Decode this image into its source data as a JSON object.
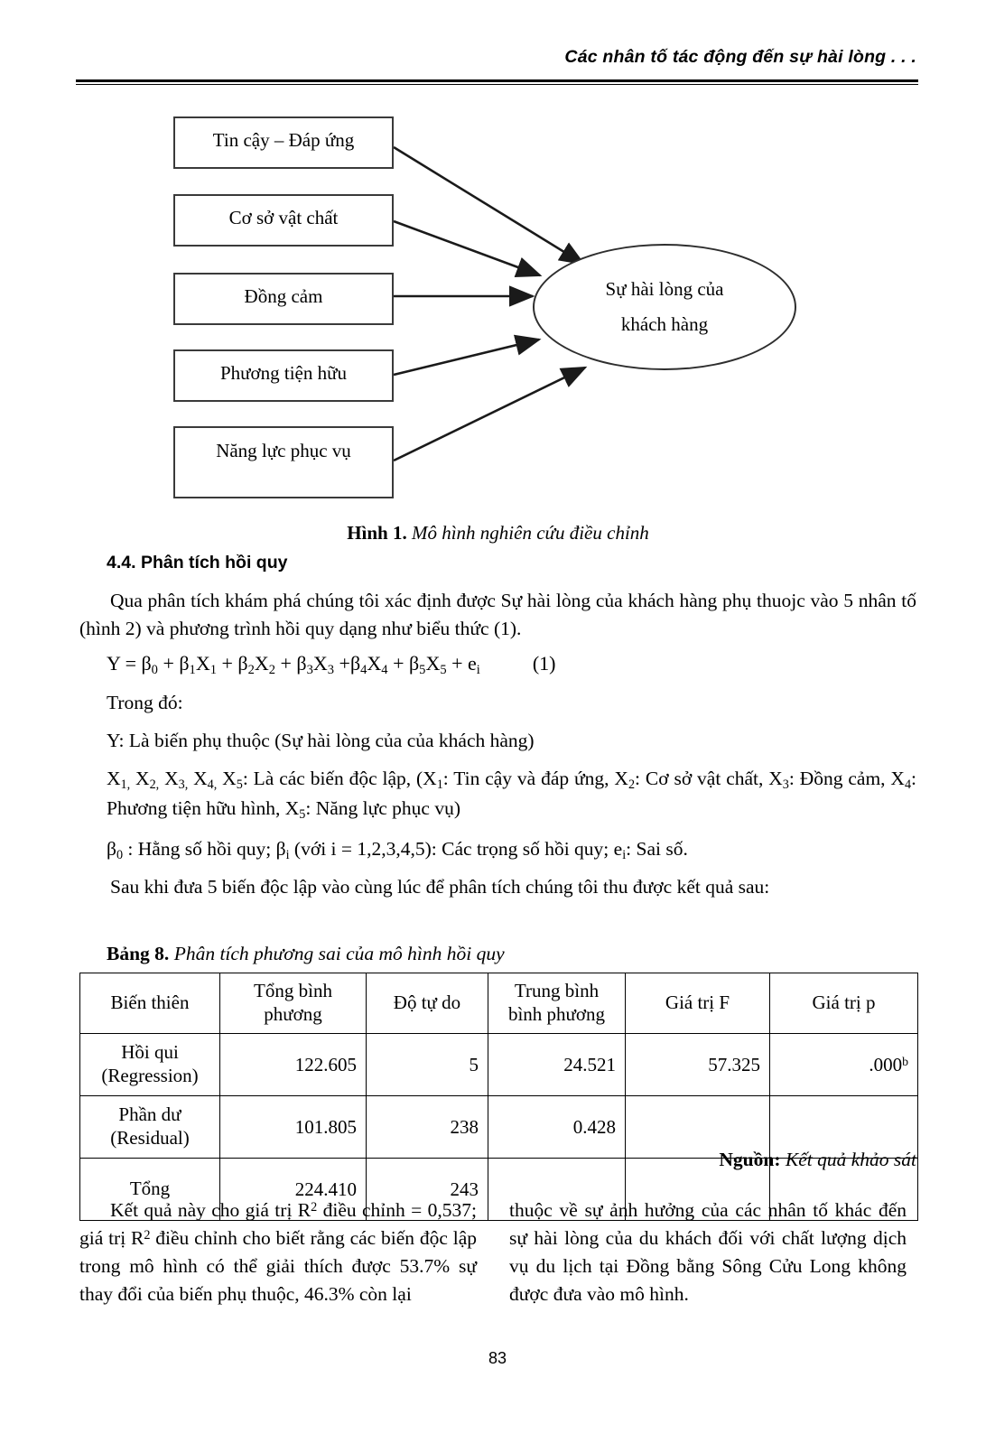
{
  "running_head": "Các nhân tố tác động đến sự hài lòng . . .",
  "figure": {
    "boxes": [
      {
        "label": "Tin cậy – Đáp ứng"
      },
      {
        "label": "Cơ sở vật chất"
      },
      {
        "label": "Đồng cảm"
      },
      {
        "label": "Phương tiện hữu"
      },
      {
        "label": "Năng lực phục vụ"
      }
    ],
    "ellipse": {
      "line1": "Sự hài lòng của",
      "line2": "khách hàng"
    },
    "caption_label": "Hình 1.",
    "caption_text": " Mô hình nghiên cứu điều chỉnh"
  },
  "section": {
    "heading": "4.4. Phân tích hồi quy",
    "intro_paragraph": "Qua phân tích khám phá chúng tôi xác định được Sự hài lòng của khách hàng phụ thuojc vào 5 nhân tố (hình 2) và phương trình hồi quy dạng như biểu thức (1).",
    "equation_number": "(1)",
    "trong_do": "Trong đó:",
    "def_y": "Y: Là biến phụ thuộc (Sự hài lòng của của khách hàng)",
    "def_beta": "β0 : Hằng số hồi quy; βi (với i = 1,2,3,4,5): Các trọng số hồi quy; ei: Sai số.",
    "after_text": "Sau khi đưa 5 biến độc lập vào cùng lúc để phân tích chúng tôi thu được kết quả sau:"
  },
  "table": {
    "caption_label": "Bảng 8.",
    "caption_text": " Phân tích phương sai của mô hình hồi quy",
    "headers": [
      "Biến thiên",
      "Tổng bình phương",
      "Độ tự do",
      "Trung bình bình phương",
      "Giá trị F",
      "Giá trị p"
    ],
    "rows": [
      {
        "label_line1": "Hồi qui",
        "label_line2": "(Regression)",
        "sum_squares": "122.605",
        "df": "5",
        "mean_square": "24.521",
        "f_value": "57.325",
        "p_value": ".000",
        "p_value_sup": "b"
      },
      {
        "label_line1": "Phần dư",
        "label_line2": "(Residual)",
        "sum_squares": "101.805",
        "df": "238",
        "mean_square": "0.428",
        "f_value": "",
        "p_value": "",
        "p_value_sup": ""
      },
      {
        "label_line1": "Tổng",
        "label_line2": "",
        "sum_squares": "224.410",
        "df": "243",
        "mean_square": "",
        "f_value": "",
        "p_value": "",
        "p_value_sup": ""
      }
    ],
    "source_label": "Nguồn:",
    "source_text": " Kết quả khảo sát"
  },
  "columns": {
    "left": "Kết quả này cho giá trị R2 điều chỉnh = 0,537; giá trị R2 điều chỉnh cho biết rằng các biến độc lập trong mô hình có thể giải thích được 53.7% sự thay đổi của biến phụ thuộc, 46.3% còn lại",
    "right": "thuộc về sự ảnh hưởng của các nhân tố khác đến sự hài lòng của du khách đối với chất lượng dịch vụ du lịch tại Đồng bằng Sông Cửu Long không được đưa vào mô hình."
  },
  "page_number": "83",
  "colors": {
    "text": "#000000",
    "rule": "#000000",
    "box_border": "#3a3a3a",
    "background": "#ffffff"
  }
}
